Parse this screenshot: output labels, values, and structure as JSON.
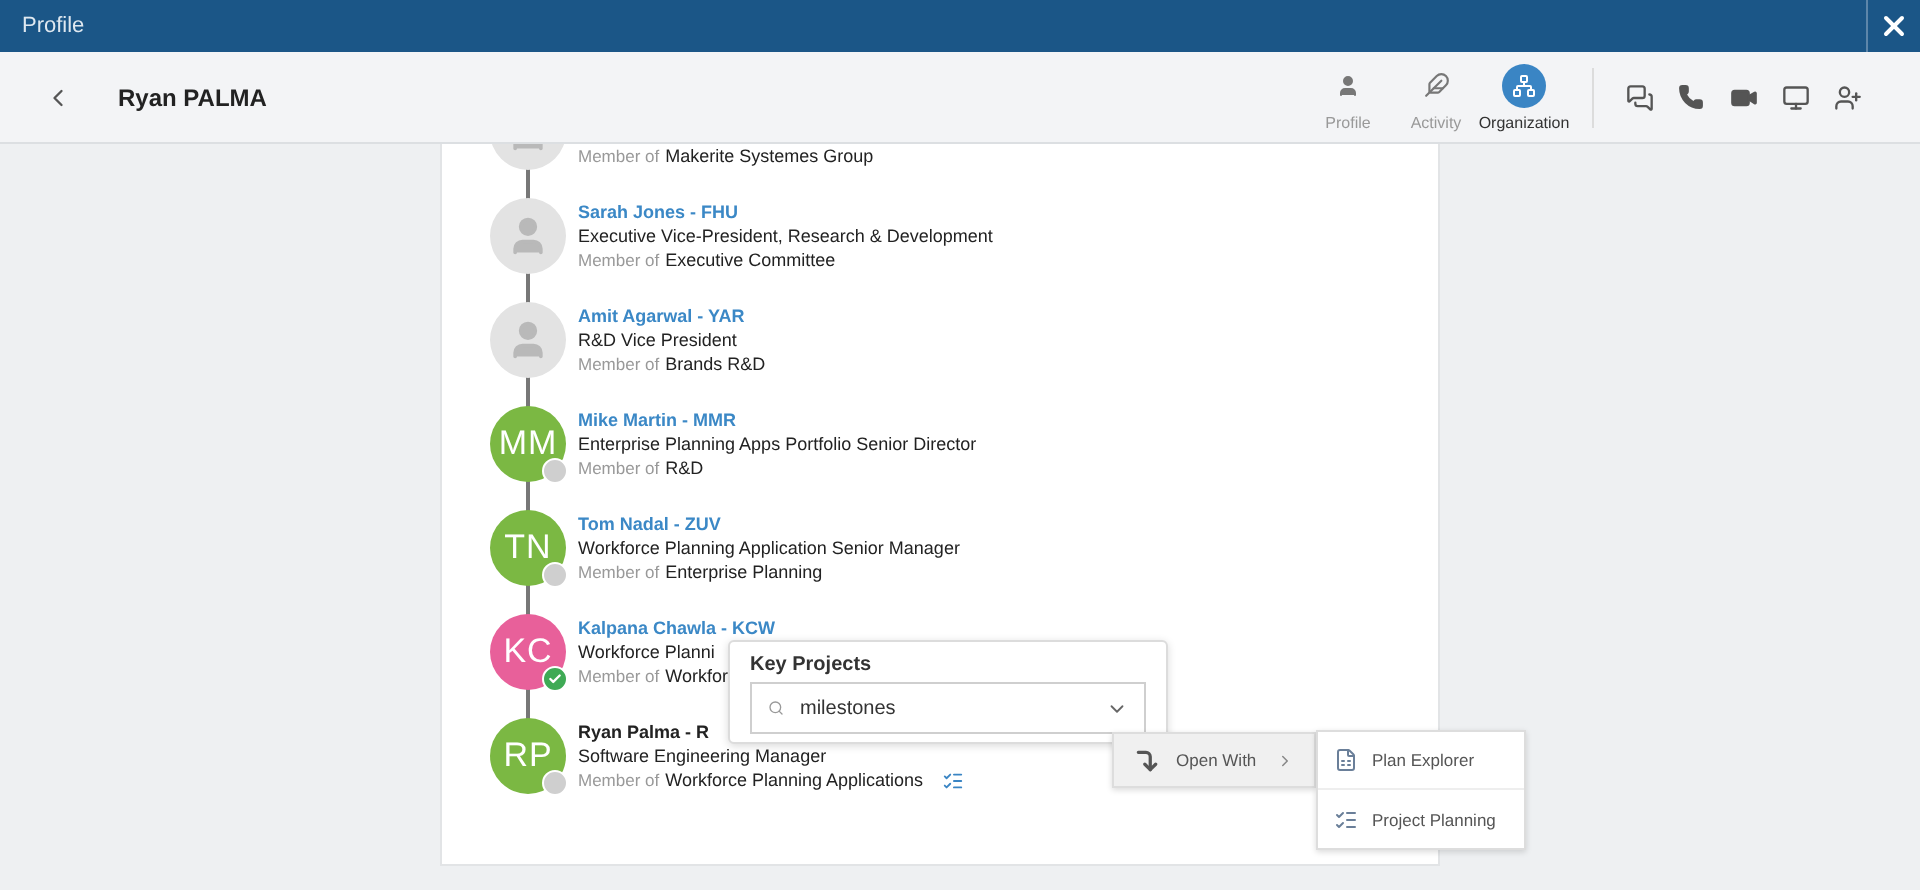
{
  "window": {
    "title": "Profile"
  },
  "header": {
    "name": "Ryan PALMA",
    "tabs": [
      {
        "label": "Profile",
        "kind": "user",
        "selected": false
      },
      {
        "label": "Activity",
        "kind": "feather",
        "selected": false
      },
      {
        "label": "Organization",
        "kind": "org",
        "selected": true
      }
    ]
  },
  "people": [
    {
      "kind": "placeholder",
      "member_prefix": "Member of",
      "member_group": "Makerite Systemes Group"
    },
    {
      "kind": "placeholder",
      "name": "Sarah Jones - FHU",
      "current": false,
      "title": "Executive Vice-President, Research & Development",
      "member_prefix": "Member of",
      "member_group": "Executive Committee"
    },
    {
      "kind": "placeholder",
      "name": "Amit Agarwal - YAR",
      "current": false,
      "title": "R&D Vice President",
      "member_prefix": "Member of",
      "member_group": "Brands R&D"
    },
    {
      "kind": "initials",
      "initials": "MM",
      "color": "#7bb843",
      "online": false,
      "name": "Mike Martin - MMR",
      "current": false,
      "title": "Enterprise Planning Apps Portfolio Senior Director",
      "member_prefix": "Member of",
      "member_group": "R&D"
    },
    {
      "kind": "initials",
      "initials": "TN",
      "color": "#7bb843",
      "online": false,
      "name": "Tom Nadal - ZUV",
      "current": false,
      "title": "Workforce Planning Application Senior Manager",
      "member_prefix": "Member of",
      "member_group": "Enterprise Planning"
    },
    {
      "kind": "initials",
      "initials": "KC",
      "color": "#e8609a",
      "online": true,
      "name": "Kalpana Chawla - KCW",
      "current": false,
      "title": "Workforce Planni",
      "member_prefix": "Member of",
      "member_group": "Workfor"
    },
    {
      "kind": "initials",
      "initials": "RP",
      "color": "#7bb843",
      "online": false,
      "name": "Ryan Palma - R",
      "current": true,
      "title": "Software Engineering Manager",
      "member_prefix": "Member of",
      "member_group": "Workforce Planning Applications",
      "has_projects": true
    }
  ],
  "key_projects": {
    "title": "Key Projects",
    "value": "milestones"
  },
  "open_with": {
    "label": "Open With"
  },
  "submenu": [
    {
      "label": "Plan Explorer"
    },
    {
      "label": "Project Planning"
    }
  ]
}
